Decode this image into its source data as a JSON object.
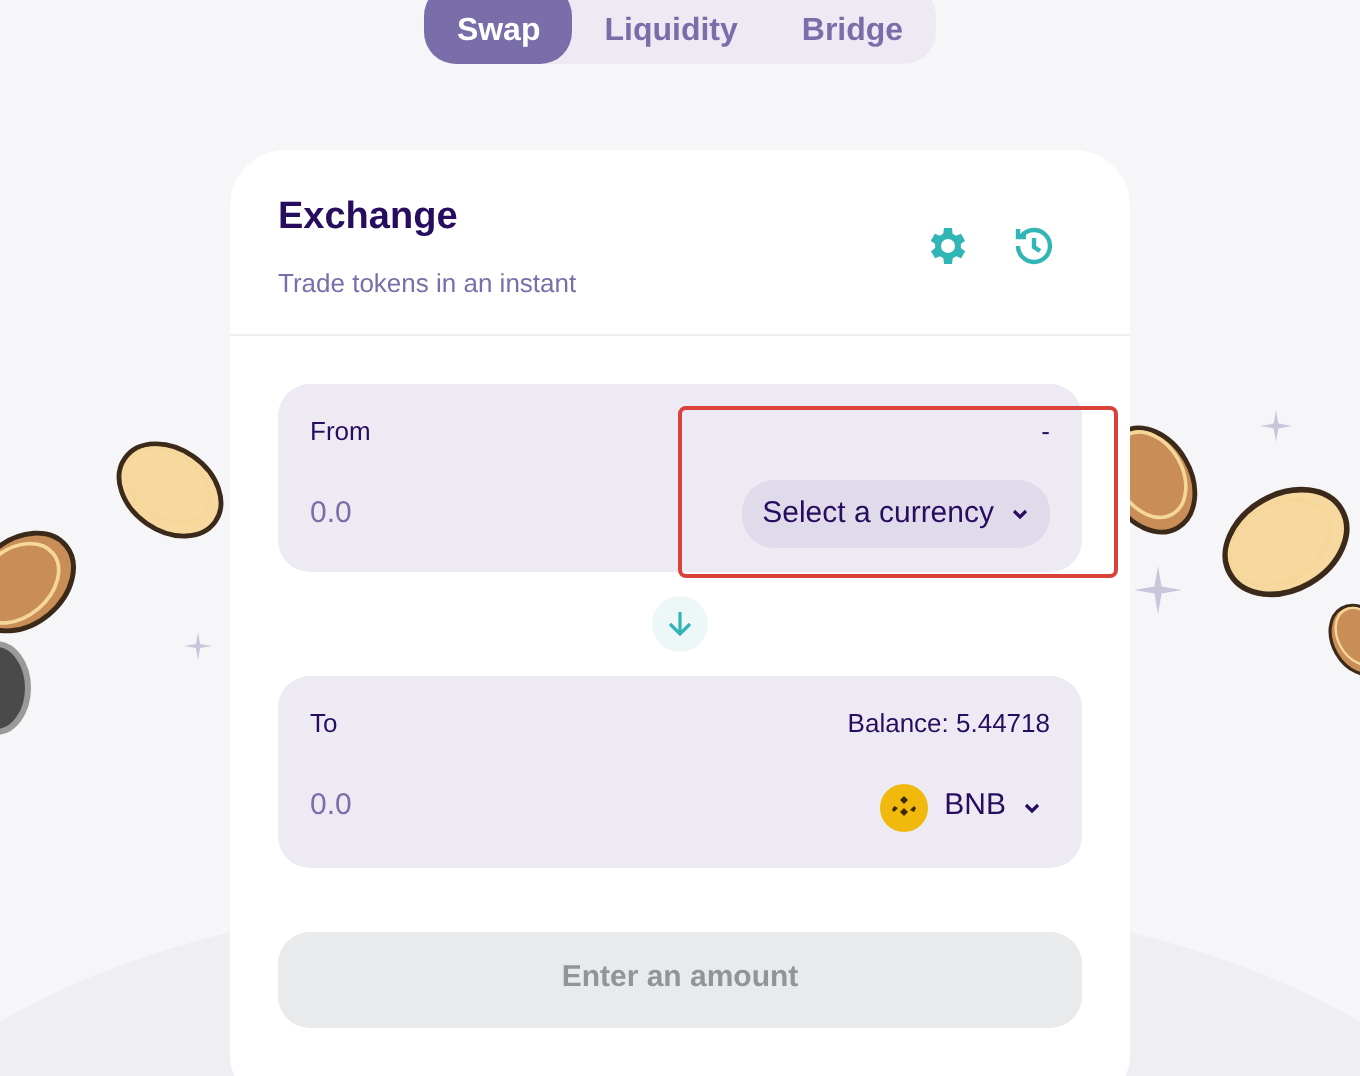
{
  "tabs": [
    {
      "label": "Swap",
      "selected": true
    },
    {
      "label": "Liquidity",
      "selected": false
    },
    {
      "label": "Bridge",
      "selected": false
    }
  ],
  "card": {
    "title": "Exchange",
    "subtitle": "Trade tokens in an instant"
  },
  "from": {
    "label": "From",
    "balance": "-",
    "placeholder": "0.0",
    "token": {
      "label": "Select a currency",
      "has_logo": false
    }
  },
  "to": {
    "label": "To",
    "balance": "Balance: 5.44718",
    "placeholder": "0.0",
    "token": {
      "label": "BNB",
      "has_logo": true
    }
  },
  "action_button": {
    "label": "Enter an amount",
    "disabled": true
  },
  "highlight": true
}
